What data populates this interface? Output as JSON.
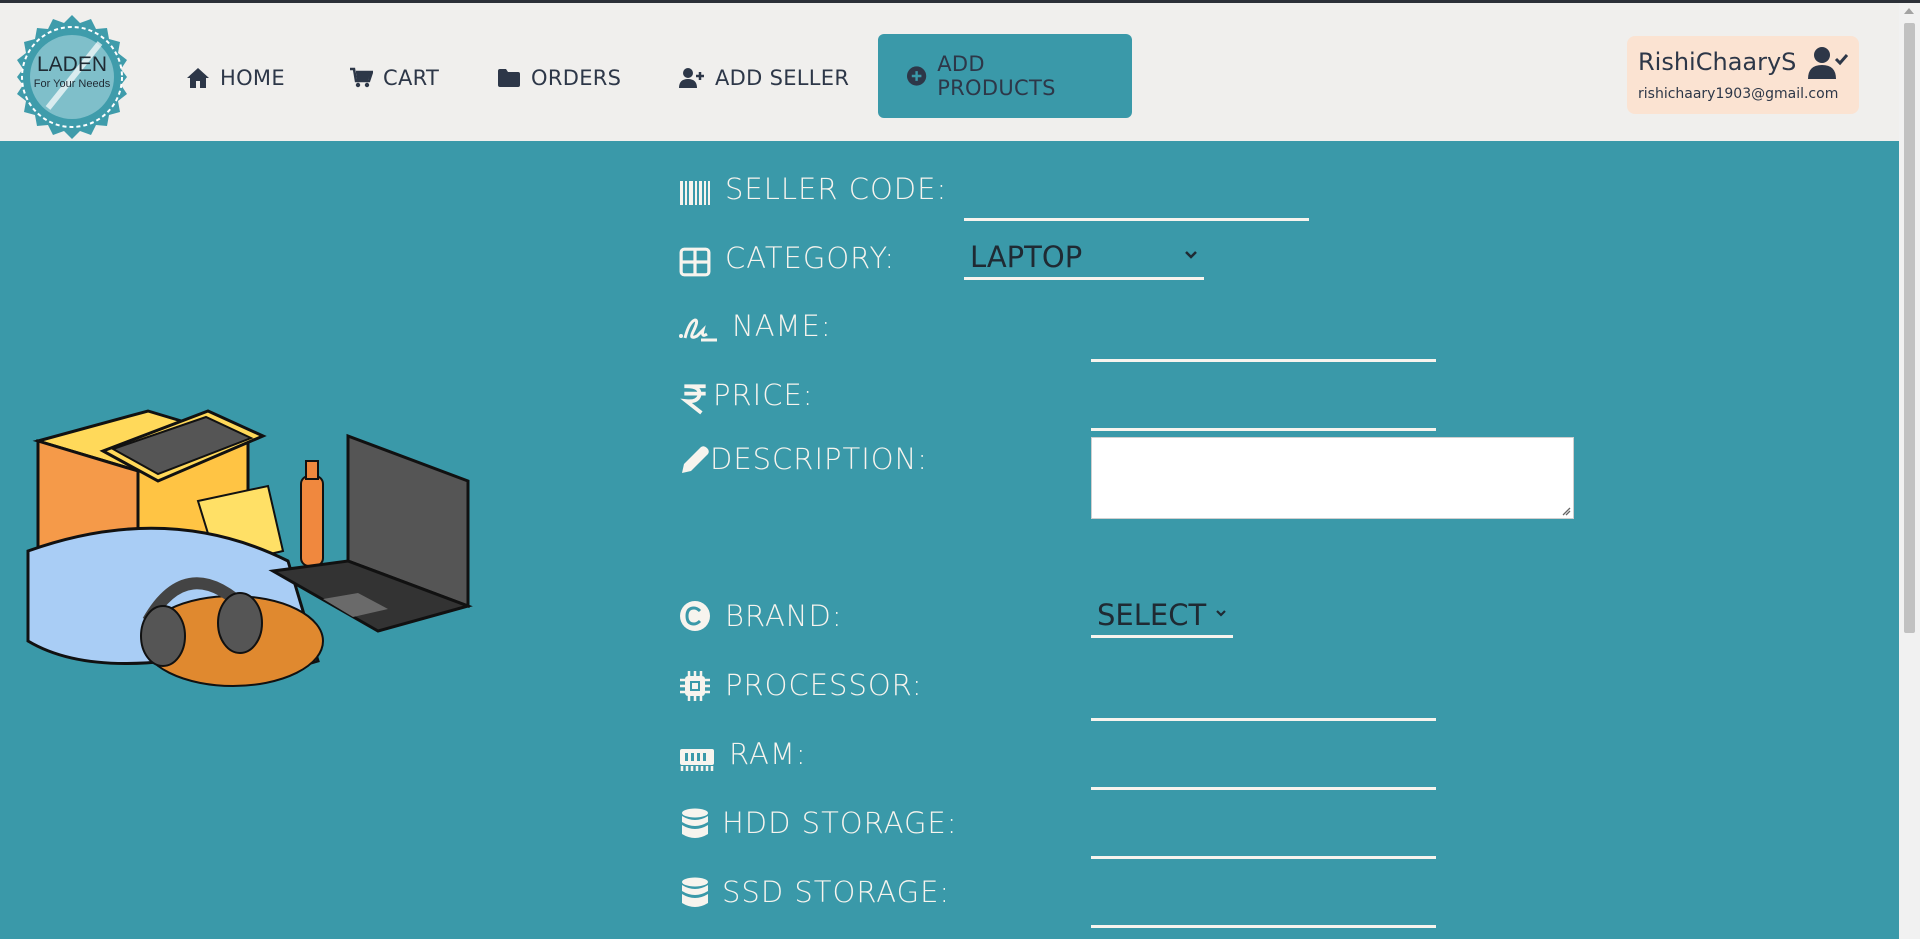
{
  "brand": {
    "logo_title": "LADEN",
    "logo_tagline": "For Your Needs"
  },
  "nav": {
    "items": [
      {
        "label": "HOME",
        "icon": "home-icon"
      },
      {
        "label": "CART",
        "icon": "cart-icon"
      },
      {
        "label": "ORDERS",
        "icon": "folder-icon"
      },
      {
        "label": "ADD SELLER",
        "icon": "user-plus-icon"
      },
      {
        "label": "ADD PRODUCTS",
        "icon": "plus-circle-icon",
        "active": true
      }
    ]
  },
  "user": {
    "name": "RishiChaaryS",
    "email": "rishichaary1903@gmail.com",
    "icon": "user-check-icon"
  },
  "form": {
    "seller_code": {
      "label": "SELLER CODE:",
      "value": "",
      "icon": "barcode-icon"
    },
    "category": {
      "label": "CATEGORY:",
      "value": "LAPTOP",
      "icon": "grid-icon"
    },
    "name": {
      "label": "NAME:",
      "value": "",
      "icon": "signature-icon"
    },
    "price": {
      "label": "PRICE:",
      "value": "",
      "icon": "rupee-icon"
    },
    "description": {
      "label": "DESCRIPTION:",
      "value": "",
      "icon": "pencil-icon"
    },
    "brand": {
      "label": "BRAND:",
      "value": "SELECT",
      "icon": "copyright-icon"
    },
    "processor": {
      "label": "PROCESSOR:",
      "value": "",
      "icon": "chip-icon"
    },
    "ram": {
      "label": "RAM:",
      "value": "",
      "icon": "memory-icon"
    },
    "hdd": {
      "label": "HDD STORAGE:",
      "value": "",
      "icon": "database-icon"
    },
    "ssd": {
      "label": "SSD STORAGE:",
      "value": "",
      "icon": "database-icon"
    }
  },
  "colors": {
    "accent": "#3a99a9",
    "header_bg": "#f0efed",
    "user_card_bg": "#fbe3d2",
    "text_light": "#f7f4ee",
    "text_dark": "#2d3748"
  }
}
